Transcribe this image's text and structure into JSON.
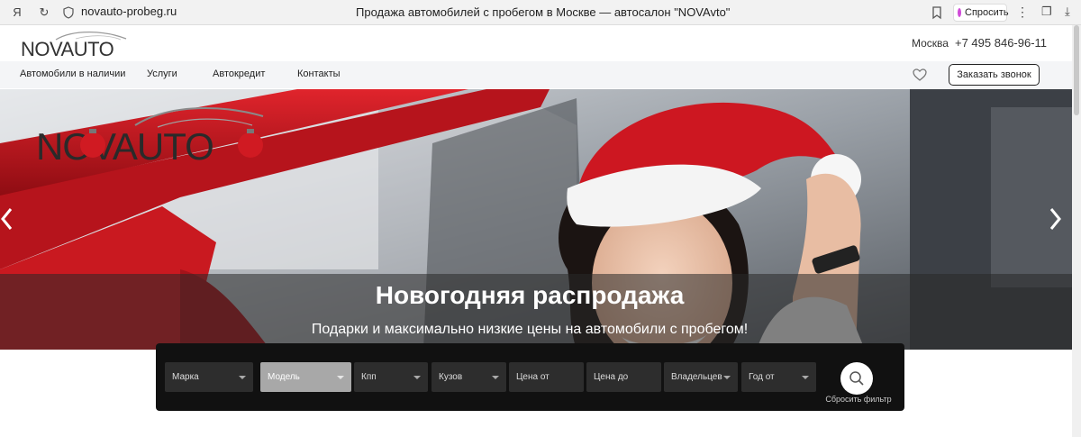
{
  "browser": {
    "url": "novauto-probeg.ru",
    "page_title": "Продажа автомобилей с пробегом в Москве — автосалон \"NOVAvto\"",
    "ask_label": "Спросить"
  },
  "header": {
    "logo_text": "NOVAUTO",
    "city": "Москва",
    "phone": "+7 495 846-96-11"
  },
  "nav": {
    "items": [
      {
        "label": "Автомобили в наличии"
      },
      {
        "label": "Услуги"
      },
      {
        "label": "Автокредит"
      },
      {
        "label": "Контакты"
      }
    ],
    "call_button": "Заказать звонок"
  },
  "banner": {
    "logo_text": "NOVAUTO",
    "headline": "Новогодняя распродажа",
    "subline": "Подарки и максимально низкие цены на автомобили с пробегом!"
  },
  "filter": {
    "fields": [
      {
        "label": "Марка",
        "dropdown": true
      },
      {
        "label": "Модель",
        "dropdown": true
      },
      {
        "label": "Кпп",
        "dropdown": true
      },
      {
        "label": "Кузов",
        "dropdown": true
      },
      {
        "label": "Цена от",
        "dropdown": false
      },
      {
        "label": "Цена до",
        "dropdown": false
      },
      {
        "label": "Владельцев",
        "dropdown": true
      },
      {
        "label": "Год от",
        "dropdown": true
      }
    ],
    "reset_label": "Сбросить фильтр"
  },
  "colors": {
    "accent_red": "#c8102e",
    "panel_dark": "#111111"
  }
}
